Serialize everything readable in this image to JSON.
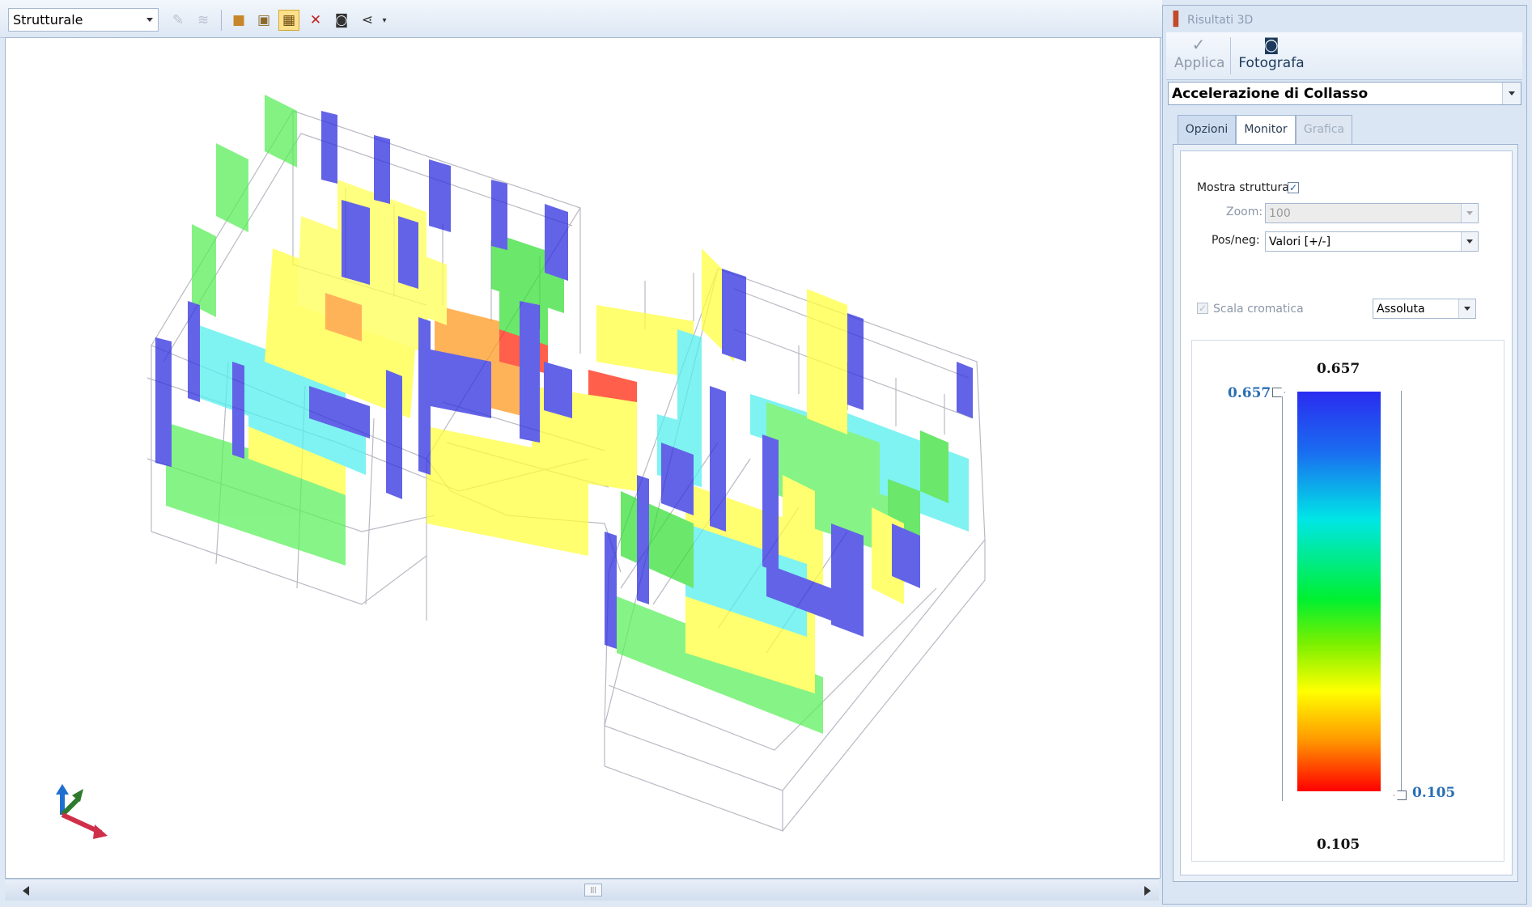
{
  "toolbar": {
    "view_select": "Strutturale",
    "icons": [
      "pencil-icon",
      "layers-icon",
      "solid-view-icon",
      "wireframe-view-icon",
      "section-view-icon",
      "delete-results-icon",
      "camera-icon",
      "share-icon"
    ]
  },
  "panel": {
    "title": "Risultati 3D",
    "apply_label": "Applica",
    "photo_label": "Fotografa",
    "analysis_select": "Accelerazione di Collasso",
    "tabs": [
      "Opzioni",
      "Monitor",
      "Grafica"
    ],
    "active_tab": "Monitor",
    "show_structure_label": "Mostra struttura",
    "show_structure_checked": true,
    "zoom_label": "Zoom:",
    "zoom_value": "100",
    "posneg_label": "Pos/neg:",
    "posneg_value": "Valori  [+/-]",
    "color_scale_label": "Scala cromatica",
    "color_scale_checked": true,
    "color_scale_value": "Assoluta"
  },
  "legend": {
    "max_label": "0.657",
    "min_label": "0.105",
    "upper_slider": "0.657",
    "lower_slider": "0.105",
    "max_color": "#2a2cf0",
    "min_color": "#ff0000"
  },
  "colors": {
    "accent": "#2a6fb4",
    "panel_bg": "#dbe6f4"
  }
}
